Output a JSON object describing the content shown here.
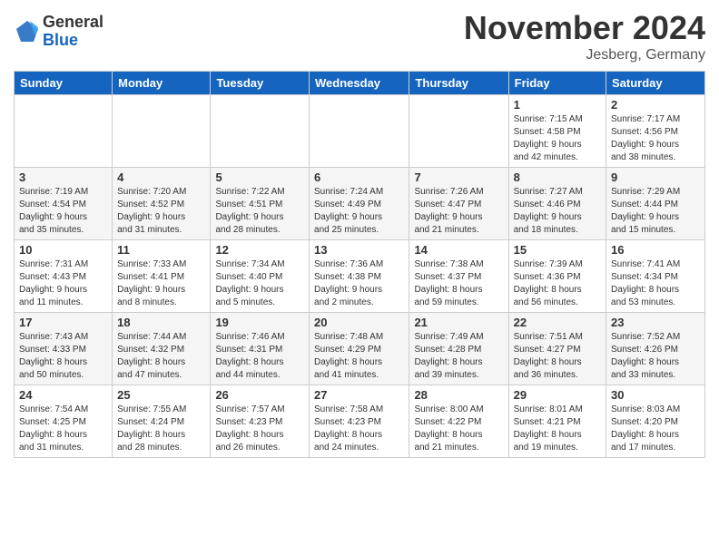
{
  "header": {
    "logo_general": "General",
    "logo_blue": "Blue",
    "month_title": "November 2024",
    "location": "Jesberg, Germany"
  },
  "weekdays": [
    "Sunday",
    "Monday",
    "Tuesday",
    "Wednesday",
    "Thursday",
    "Friday",
    "Saturday"
  ],
  "weeks": [
    [
      {
        "day": "",
        "info": ""
      },
      {
        "day": "",
        "info": ""
      },
      {
        "day": "",
        "info": ""
      },
      {
        "day": "",
        "info": ""
      },
      {
        "day": "",
        "info": ""
      },
      {
        "day": "1",
        "info": "Sunrise: 7:15 AM\nSunset: 4:58 PM\nDaylight: 9 hours\nand 42 minutes."
      },
      {
        "day": "2",
        "info": "Sunrise: 7:17 AM\nSunset: 4:56 PM\nDaylight: 9 hours\nand 38 minutes."
      }
    ],
    [
      {
        "day": "3",
        "info": "Sunrise: 7:19 AM\nSunset: 4:54 PM\nDaylight: 9 hours\nand 35 minutes."
      },
      {
        "day": "4",
        "info": "Sunrise: 7:20 AM\nSunset: 4:52 PM\nDaylight: 9 hours\nand 31 minutes."
      },
      {
        "day": "5",
        "info": "Sunrise: 7:22 AM\nSunset: 4:51 PM\nDaylight: 9 hours\nand 28 minutes."
      },
      {
        "day": "6",
        "info": "Sunrise: 7:24 AM\nSunset: 4:49 PM\nDaylight: 9 hours\nand 25 minutes."
      },
      {
        "day": "7",
        "info": "Sunrise: 7:26 AM\nSunset: 4:47 PM\nDaylight: 9 hours\nand 21 minutes."
      },
      {
        "day": "8",
        "info": "Sunrise: 7:27 AM\nSunset: 4:46 PM\nDaylight: 9 hours\nand 18 minutes."
      },
      {
        "day": "9",
        "info": "Sunrise: 7:29 AM\nSunset: 4:44 PM\nDaylight: 9 hours\nand 15 minutes."
      }
    ],
    [
      {
        "day": "10",
        "info": "Sunrise: 7:31 AM\nSunset: 4:43 PM\nDaylight: 9 hours\nand 11 minutes."
      },
      {
        "day": "11",
        "info": "Sunrise: 7:33 AM\nSunset: 4:41 PM\nDaylight: 9 hours\nand 8 minutes."
      },
      {
        "day": "12",
        "info": "Sunrise: 7:34 AM\nSunset: 4:40 PM\nDaylight: 9 hours\nand 5 minutes."
      },
      {
        "day": "13",
        "info": "Sunrise: 7:36 AM\nSunset: 4:38 PM\nDaylight: 9 hours\nand 2 minutes."
      },
      {
        "day": "14",
        "info": "Sunrise: 7:38 AM\nSunset: 4:37 PM\nDaylight: 8 hours\nand 59 minutes."
      },
      {
        "day": "15",
        "info": "Sunrise: 7:39 AM\nSunset: 4:36 PM\nDaylight: 8 hours\nand 56 minutes."
      },
      {
        "day": "16",
        "info": "Sunrise: 7:41 AM\nSunset: 4:34 PM\nDaylight: 8 hours\nand 53 minutes."
      }
    ],
    [
      {
        "day": "17",
        "info": "Sunrise: 7:43 AM\nSunset: 4:33 PM\nDaylight: 8 hours\nand 50 minutes."
      },
      {
        "day": "18",
        "info": "Sunrise: 7:44 AM\nSunset: 4:32 PM\nDaylight: 8 hours\nand 47 minutes."
      },
      {
        "day": "19",
        "info": "Sunrise: 7:46 AM\nSunset: 4:31 PM\nDaylight: 8 hours\nand 44 minutes."
      },
      {
        "day": "20",
        "info": "Sunrise: 7:48 AM\nSunset: 4:29 PM\nDaylight: 8 hours\nand 41 minutes."
      },
      {
        "day": "21",
        "info": "Sunrise: 7:49 AM\nSunset: 4:28 PM\nDaylight: 8 hours\nand 39 minutes."
      },
      {
        "day": "22",
        "info": "Sunrise: 7:51 AM\nSunset: 4:27 PM\nDaylight: 8 hours\nand 36 minutes."
      },
      {
        "day": "23",
        "info": "Sunrise: 7:52 AM\nSunset: 4:26 PM\nDaylight: 8 hours\nand 33 minutes."
      }
    ],
    [
      {
        "day": "24",
        "info": "Sunrise: 7:54 AM\nSunset: 4:25 PM\nDaylight: 8 hours\nand 31 minutes."
      },
      {
        "day": "25",
        "info": "Sunrise: 7:55 AM\nSunset: 4:24 PM\nDaylight: 8 hours\nand 28 minutes."
      },
      {
        "day": "26",
        "info": "Sunrise: 7:57 AM\nSunset: 4:23 PM\nDaylight: 8 hours\nand 26 minutes."
      },
      {
        "day": "27",
        "info": "Sunrise: 7:58 AM\nSunset: 4:23 PM\nDaylight: 8 hours\nand 24 minutes."
      },
      {
        "day": "28",
        "info": "Sunrise: 8:00 AM\nSunset: 4:22 PM\nDaylight: 8 hours\nand 21 minutes."
      },
      {
        "day": "29",
        "info": "Sunrise: 8:01 AM\nSunset: 4:21 PM\nDaylight: 8 hours\nand 19 minutes."
      },
      {
        "day": "30",
        "info": "Sunrise: 8:03 AM\nSunset: 4:20 PM\nDaylight: 8 hours\nand 17 minutes."
      }
    ]
  ]
}
